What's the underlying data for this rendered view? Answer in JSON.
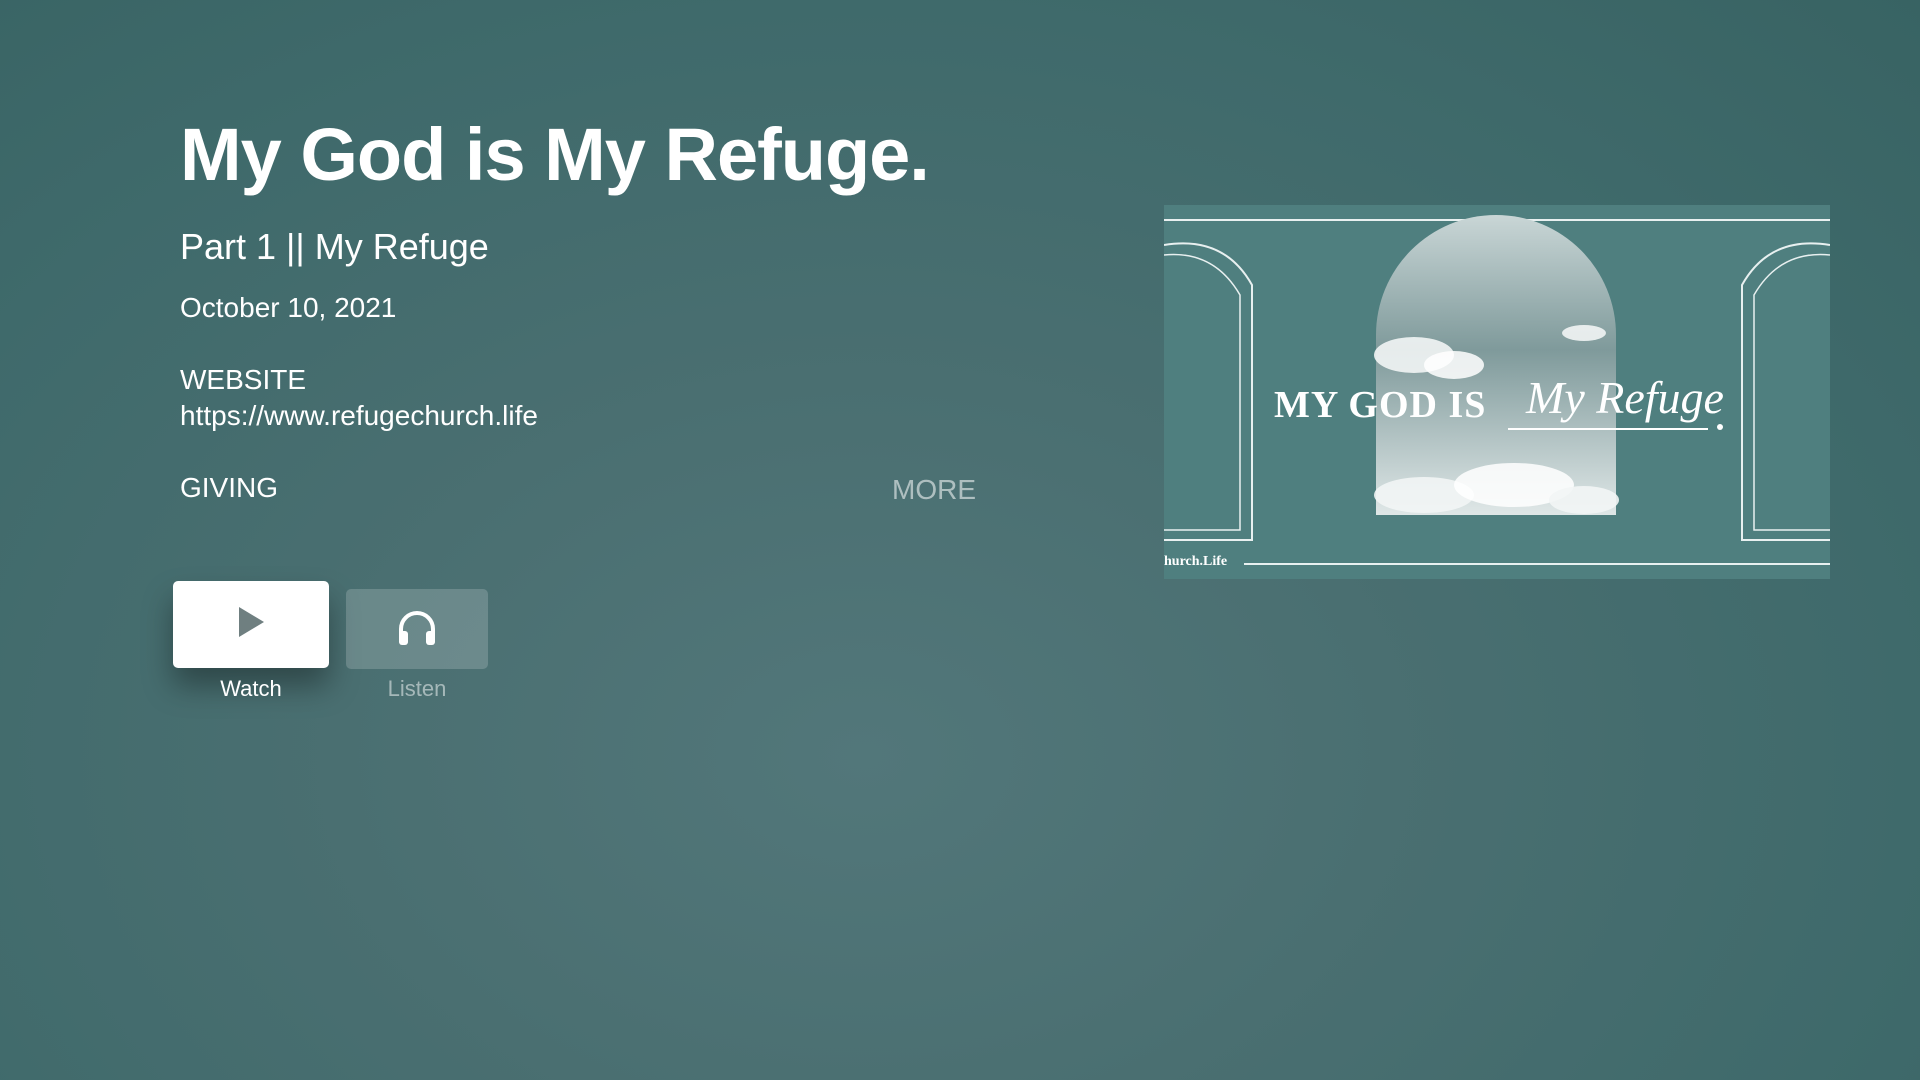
{
  "sermon": {
    "title": "My God is My Refuge.",
    "subtitle": "Part 1 || My Refuge",
    "date": "October 10, 2021"
  },
  "website": {
    "label": "WEBSITE",
    "url": "https://www.refugechurch.life"
  },
  "giving": {
    "label": "GIVING"
  },
  "more": {
    "label": "MORE"
  },
  "actions": {
    "watch": {
      "label": "Watch",
      "icon": "play-icon"
    },
    "listen": {
      "label": "Listen",
      "icon": "headphones-icon"
    }
  },
  "artwork": {
    "main_text": "MY GOD IS",
    "script_text": "My Refuge",
    "footer_text": "hurch.Life"
  },
  "colors": {
    "background": "#46706f",
    "artwork_bg": "#4f7f7f"
  }
}
